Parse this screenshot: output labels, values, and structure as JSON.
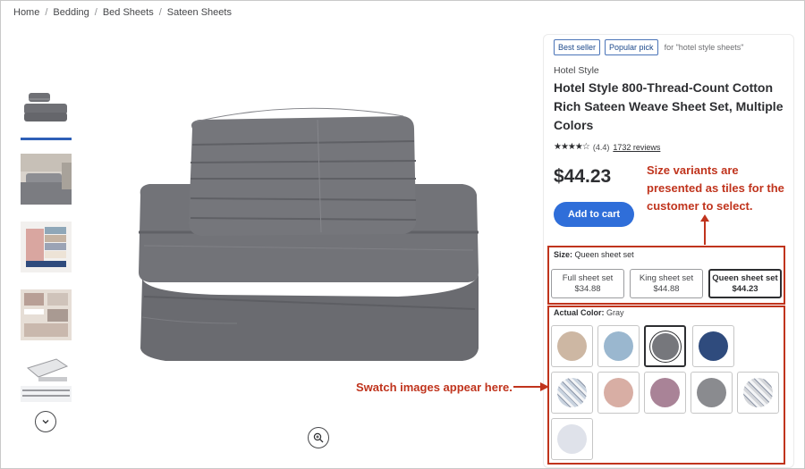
{
  "breadcrumb": [
    "Home",
    "Bedding",
    "Bed Sheets",
    "Sateen Sheets"
  ],
  "breadcrumb_separator": "/",
  "badges": {
    "best_seller": "Best seller",
    "popular_pick": "Popular pick",
    "context": "for \"hotel style sheets\""
  },
  "product": {
    "brand": "Hotel Style",
    "title": "Hotel Style 800-Thread-Count Cotton Rich Sateen Weave Sheet Set, Multiple Colors",
    "stars": "★★★★☆",
    "rating_value": 4.4,
    "rating_text": "(4.4)",
    "reviews": "1732 reviews",
    "price": "$44.23",
    "add_to_cart": "Add to cart"
  },
  "size": {
    "label": "Size:",
    "selected": "Queen sheet set",
    "options": [
      {
        "name": "Full sheet set",
        "price": "$34.88",
        "selected": false
      },
      {
        "name": "King sheet set",
        "price": "$44.88",
        "selected": false
      },
      {
        "name": "Queen sheet set",
        "price": "$44.23",
        "selected": true
      }
    ]
  },
  "color": {
    "label": "Actual Color:",
    "selected": "Gray",
    "swatches": [
      {
        "color": "#cdb7a3",
        "selected": false
      },
      {
        "color": "#9ab7cf",
        "selected": false
      },
      {
        "color": "#76777c",
        "selected": true
      },
      {
        "color": "#2f4b7d",
        "selected": false
      },
      {
        "color": "#c9d3df",
        "pattern": "print",
        "selected": false
      },
      {
        "color": "#d8aea4",
        "selected": false
      },
      {
        "color": "#a98397",
        "selected": false
      },
      {
        "color": "#8a8b8f",
        "selected": false
      },
      {
        "color": "#d4d6da",
        "pattern": "print",
        "selected": false
      },
      {
        "color": "#dfe2ea",
        "selected": false
      }
    ]
  },
  "annotations": {
    "size_note": "Size variants are presented as tiles for the customer to select.",
    "swatch_note": "Swatch images appear here."
  },
  "icons": {
    "scroll_down": "chevron-down-icon",
    "zoom": "zoom-in-icon"
  },
  "colors": {
    "accent_blue": "#2f6ed9",
    "annotation_red": "#c0341d",
    "sheet_gray": "#6f7075"
  }
}
